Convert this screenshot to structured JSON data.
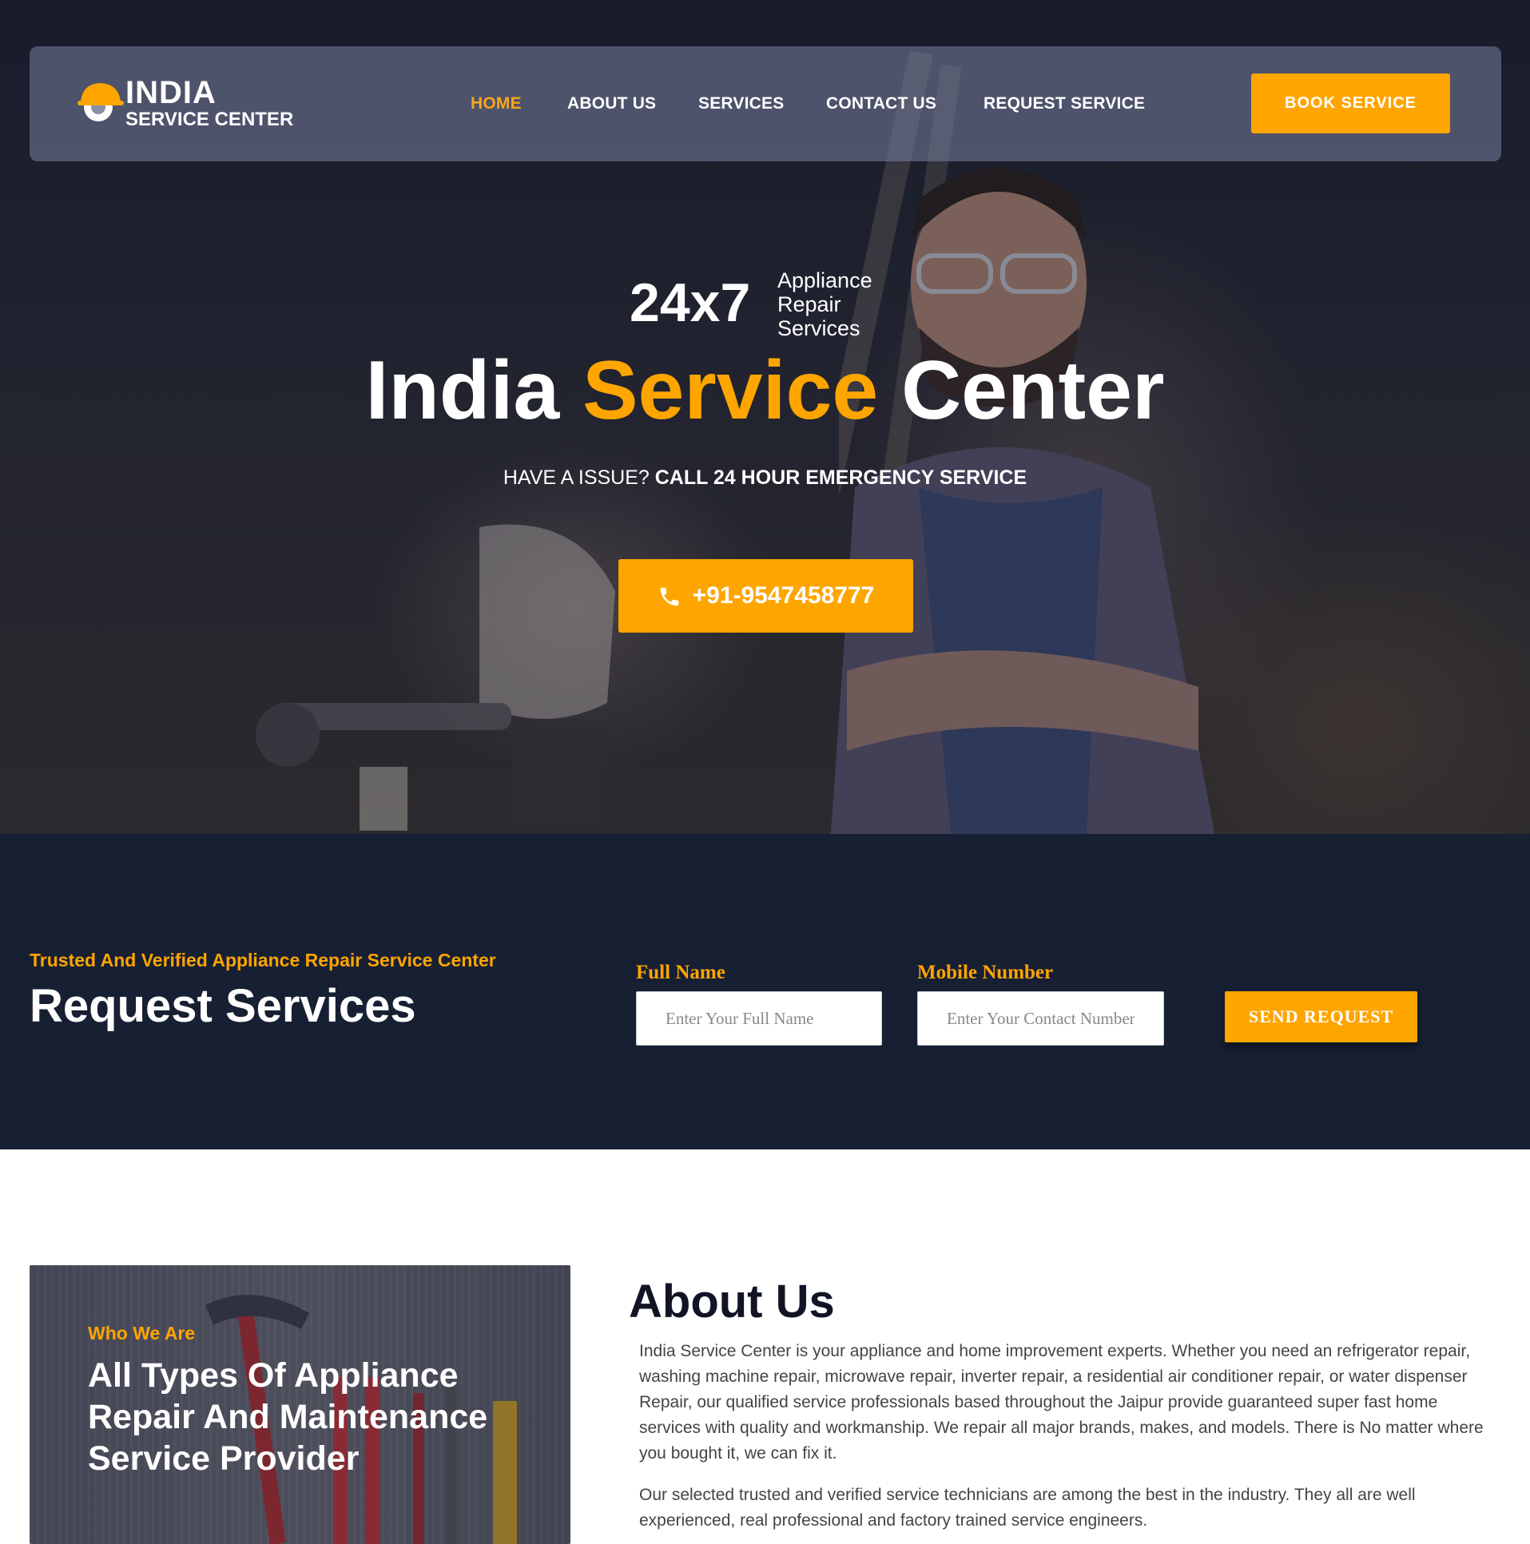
{
  "nav": {
    "logo_line1": "INDIA",
    "logo_line2": "SERVICE CENTER",
    "links": [
      "HOME",
      "ABOUT US",
      "SERVICES",
      "CONTACT US",
      "REQUEST SERVICE"
    ],
    "active": "HOME",
    "book_label": "BOOK SERVICE"
  },
  "hero": {
    "badge_big": "24x7",
    "badge_lines": [
      "Appliance",
      "Repair",
      "Services"
    ],
    "title_part1": "India ",
    "title_accent": "Service",
    "title_part2": " Center",
    "subtitle_plain": "HAVE A ISSUE? ",
    "subtitle_bold": "CALL 24 HOUR EMERGENCY SERVICE",
    "phone": "+91-9547458777"
  },
  "request": {
    "tagline": "Trusted And Verified Appliance Repair Service Center",
    "title": "Request Services",
    "full_name_label": "Full Name",
    "full_name_placeholder": "Enter Your Full Name",
    "mobile_label": "Mobile Number",
    "mobile_placeholder": "Enter Your Contact Number",
    "submit_label": "SEND REQUEST"
  },
  "about": {
    "card_tag": "Who We Are",
    "card_title": "All Types Of Appliance Repair And Maintenance Service Provider",
    "title": "About Us",
    "paragraph1": "India Service Center is your appliance and home improvement experts. Whether you need an refrigerator repair, washing machine repair, microwave repair, inverter repair, a residential air conditioner repair, or water dispenser Repair, our qualified service professionals based throughout the Jaipur provide guaranteed super fast home services with quality and workmanship. We repair all major brands, makes, and models. There is No matter where you bought it, we can fix it.",
    "paragraph2": "Our selected trusted and verified service technicians are among the best in the industry. They all are well experienced, real professional and factory trained service engineers."
  },
  "colors": {
    "accent": "#ffa500",
    "dark_section": "#171f33",
    "heading": "#101424"
  },
  "icons": [
    "helmet-gear-logo-icon",
    "phone-icon"
  ]
}
